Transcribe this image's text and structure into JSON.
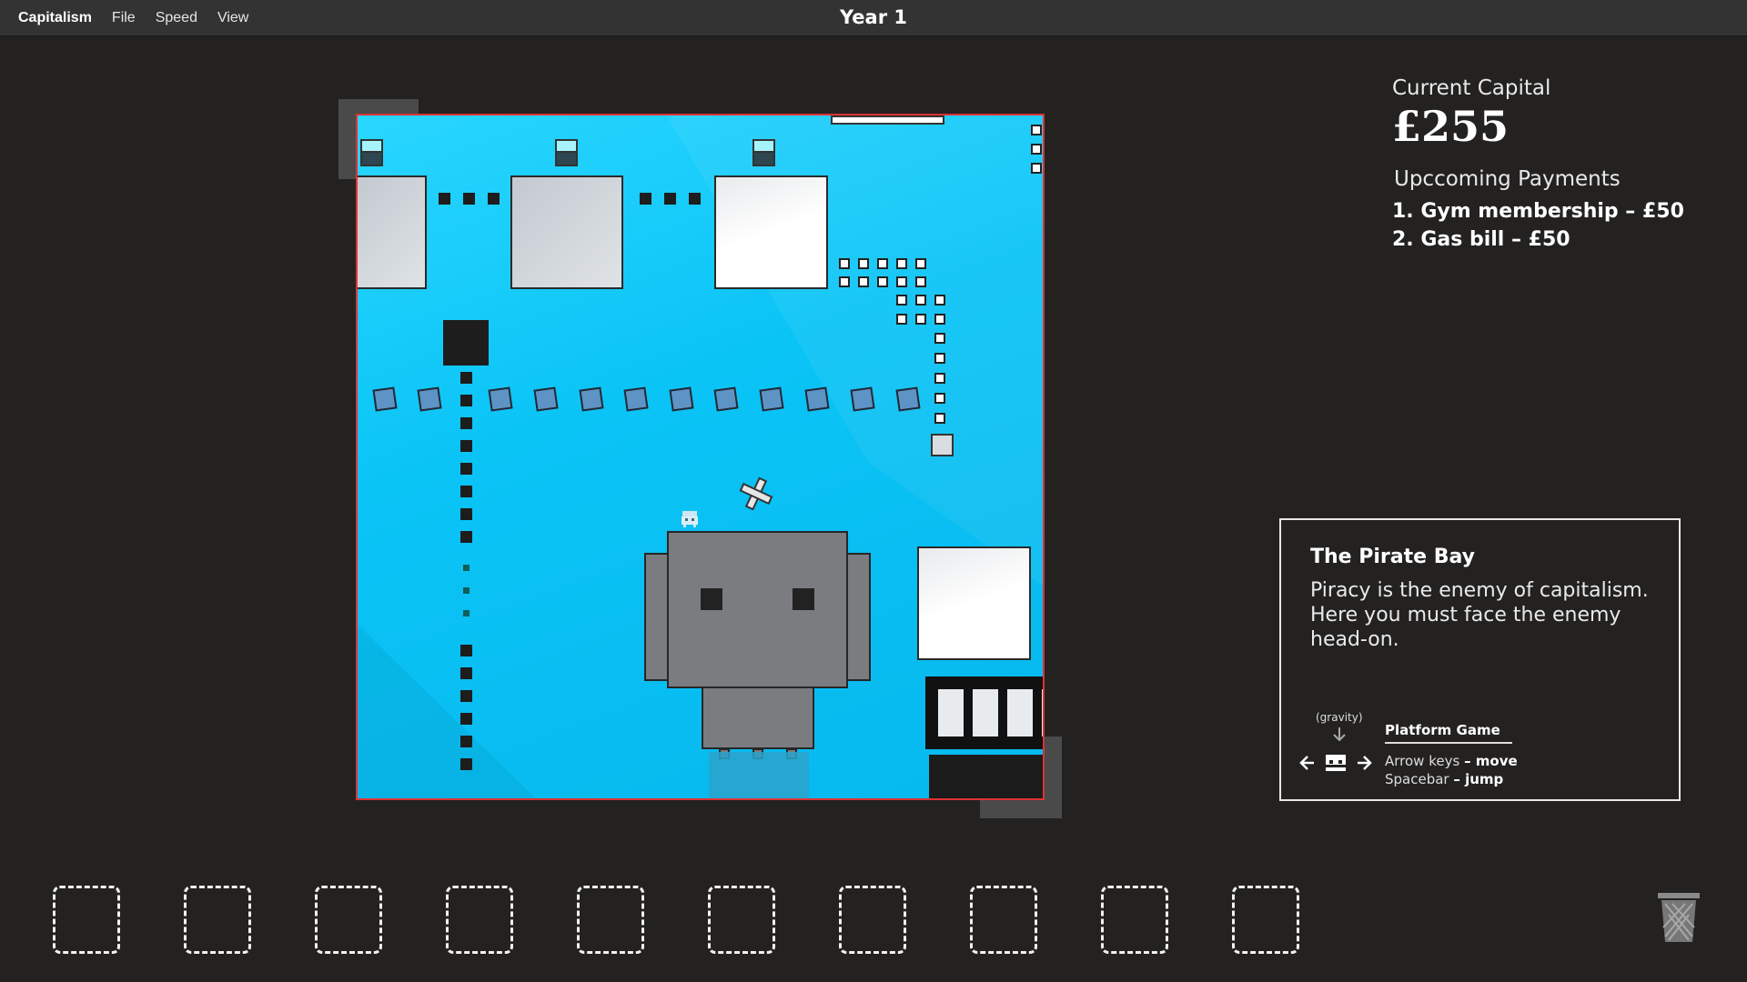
{
  "menu": {
    "app": "Capitalism",
    "items": [
      "File",
      "Speed",
      "View"
    ]
  },
  "header": {
    "year": "Year 1"
  },
  "capital": {
    "label": "Current Capital",
    "value": "£255"
  },
  "payments": {
    "label": "Upccoming Payments",
    "items": [
      "1. Gym membership – £50",
      "2. Gas bill – £50"
    ]
  },
  "info": {
    "title": "The Pirate Bay",
    "description": "Piracy is the enemy of capitalism. Here you must face the enemy head-on.",
    "gravity_label": "(gravity)",
    "controls_title": "Platform Game",
    "controls": [
      {
        "key": "Arrow keys",
        "action": "– move"
      },
      {
        "key": "Spacebar",
        "action": "– jump"
      }
    ]
  },
  "inventory": {
    "slot_count": 10
  },
  "colors": {
    "background": "#232221",
    "game_sky": "#0bc4f6",
    "border_accent": "#dd3333"
  },
  "icons": {
    "player": "pirate-player-icon",
    "cross": "cross-collectible-icon",
    "trash": "trash-icon"
  }
}
